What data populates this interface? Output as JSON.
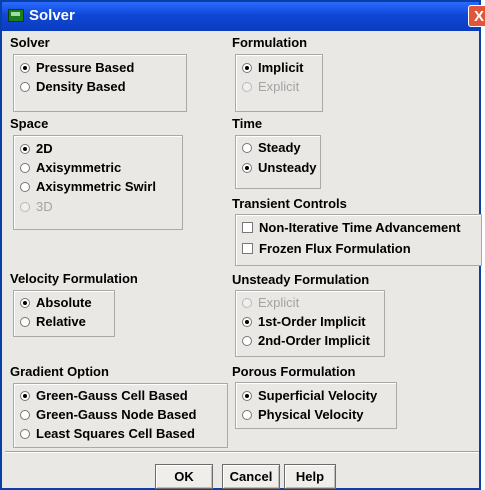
{
  "window": {
    "title": "Solver",
    "close_glyph": "X"
  },
  "solver": {
    "label": "Solver",
    "options": [
      "Pressure Based",
      "Density Based"
    ],
    "selected": "Pressure Based"
  },
  "formulation": {
    "label": "Formulation",
    "options": [
      "Implicit",
      "Explicit"
    ],
    "selected": "Implicit",
    "disabled": [
      "Explicit"
    ]
  },
  "space": {
    "label": "Space",
    "options": [
      "2D",
      "Axisymmetric",
      "Axisymmetric Swirl",
      "3D"
    ],
    "selected": "2D",
    "disabled": [
      "3D"
    ]
  },
  "time": {
    "label": "Time",
    "options": [
      "Steady",
      "Unsteady"
    ],
    "selected": "Unsteady"
  },
  "transient": {
    "label": "Transient Controls",
    "options": [
      "Non-Iterative Time Advancement",
      "Frozen Flux Formulation"
    ],
    "checked": []
  },
  "velocity": {
    "label": "Velocity Formulation",
    "options": [
      "Absolute",
      "Relative"
    ],
    "selected": "Absolute"
  },
  "unsteady": {
    "label": "Unsteady Formulation",
    "options": [
      "Explicit",
      "1st-Order Implicit",
      "2nd-Order Implicit"
    ],
    "selected": "1st-Order Implicit",
    "disabled": [
      "Explicit"
    ]
  },
  "gradient": {
    "label": "Gradient Option",
    "options": [
      "Green-Gauss Cell Based",
      "Green-Gauss Node Based",
      "Least Squares Cell Based"
    ],
    "selected": "Green-Gauss Cell Based"
  },
  "porous": {
    "label": "Porous Formulation",
    "options": [
      "Superficial Velocity",
      "Physical Velocity"
    ],
    "selected": "Superficial Velocity"
  },
  "buttons": {
    "ok": "OK",
    "cancel": "Cancel",
    "help": "Help"
  },
  "colors": {
    "titlebar": "#0f47d6",
    "panel": "#e9e8e4",
    "close": "#e0563a"
  },
  "icons": {
    "window_icon": "solver-window-icon",
    "close": "close-icon"
  }
}
